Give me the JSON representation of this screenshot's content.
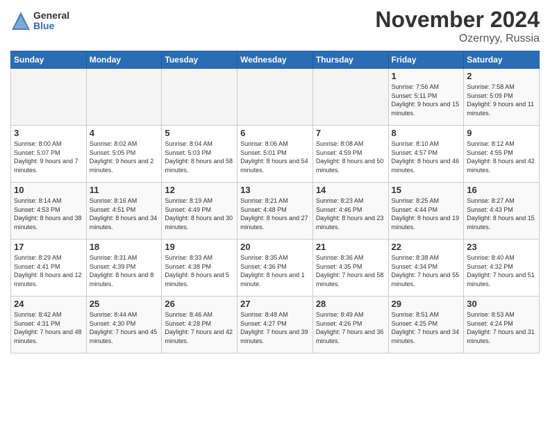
{
  "header": {
    "logo_general": "General",
    "logo_blue": "Blue",
    "title": "November 2024",
    "location": "Ozernyy, Russia"
  },
  "days_of_week": [
    "Sunday",
    "Monday",
    "Tuesday",
    "Wednesday",
    "Thursday",
    "Friday",
    "Saturday"
  ],
  "weeks": [
    [
      {
        "day": "",
        "info": ""
      },
      {
        "day": "",
        "info": ""
      },
      {
        "day": "",
        "info": ""
      },
      {
        "day": "",
        "info": ""
      },
      {
        "day": "",
        "info": ""
      },
      {
        "day": "1",
        "info": "Sunrise: 7:56 AM\nSunset: 5:11 PM\nDaylight: 9 hours and 15 minutes."
      },
      {
        "day": "2",
        "info": "Sunrise: 7:58 AM\nSunset: 5:09 PM\nDaylight: 9 hours and 11 minutes."
      }
    ],
    [
      {
        "day": "3",
        "info": "Sunrise: 8:00 AM\nSunset: 5:07 PM\nDaylight: 9 hours and 7 minutes."
      },
      {
        "day": "4",
        "info": "Sunrise: 8:02 AM\nSunset: 5:05 PM\nDaylight: 9 hours and 2 minutes."
      },
      {
        "day": "5",
        "info": "Sunrise: 8:04 AM\nSunset: 5:03 PM\nDaylight: 8 hours and 58 minutes."
      },
      {
        "day": "6",
        "info": "Sunrise: 8:06 AM\nSunset: 5:01 PM\nDaylight: 8 hours and 54 minutes."
      },
      {
        "day": "7",
        "info": "Sunrise: 8:08 AM\nSunset: 4:59 PM\nDaylight: 8 hours and 50 minutes."
      },
      {
        "day": "8",
        "info": "Sunrise: 8:10 AM\nSunset: 4:57 PM\nDaylight: 8 hours and 46 minutes."
      },
      {
        "day": "9",
        "info": "Sunrise: 8:12 AM\nSunset: 4:55 PM\nDaylight: 8 hours and 42 minutes."
      }
    ],
    [
      {
        "day": "10",
        "info": "Sunrise: 8:14 AM\nSunset: 4:53 PM\nDaylight: 8 hours and 38 minutes."
      },
      {
        "day": "11",
        "info": "Sunrise: 8:16 AM\nSunset: 4:51 PM\nDaylight: 8 hours and 34 minutes."
      },
      {
        "day": "12",
        "info": "Sunrise: 8:19 AM\nSunset: 4:49 PM\nDaylight: 8 hours and 30 minutes."
      },
      {
        "day": "13",
        "info": "Sunrise: 8:21 AM\nSunset: 4:48 PM\nDaylight: 8 hours and 27 minutes."
      },
      {
        "day": "14",
        "info": "Sunrise: 8:23 AM\nSunset: 4:46 PM\nDaylight: 8 hours and 23 minutes."
      },
      {
        "day": "15",
        "info": "Sunrise: 8:25 AM\nSunset: 4:44 PM\nDaylight: 8 hours and 19 minutes."
      },
      {
        "day": "16",
        "info": "Sunrise: 8:27 AM\nSunset: 4:43 PM\nDaylight: 8 hours and 15 minutes."
      }
    ],
    [
      {
        "day": "17",
        "info": "Sunrise: 8:29 AM\nSunset: 4:41 PM\nDaylight: 8 hours and 12 minutes."
      },
      {
        "day": "18",
        "info": "Sunrise: 8:31 AM\nSunset: 4:39 PM\nDaylight: 8 hours and 8 minutes."
      },
      {
        "day": "19",
        "info": "Sunrise: 8:33 AM\nSunset: 4:38 PM\nDaylight: 8 hours and 5 minutes."
      },
      {
        "day": "20",
        "info": "Sunrise: 8:35 AM\nSunset: 4:36 PM\nDaylight: 8 hours and 1 minute."
      },
      {
        "day": "21",
        "info": "Sunrise: 8:36 AM\nSunset: 4:35 PM\nDaylight: 7 hours and 58 minutes."
      },
      {
        "day": "22",
        "info": "Sunrise: 8:38 AM\nSunset: 4:34 PM\nDaylight: 7 hours and 55 minutes."
      },
      {
        "day": "23",
        "info": "Sunrise: 8:40 AM\nSunset: 4:32 PM\nDaylight: 7 hours and 51 minutes."
      }
    ],
    [
      {
        "day": "24",
        "info": "Sunrise: 8:42 AM\nSunset: 4:31 PM\nDaylight: 7 hours and 48 minutes."
      },
      {
        "day": "25",
        "info": "Sunrise: 8:44 AM\nSunset: 4:30 PM\nDaylight: 7 hours and 45 minutes."
      },
      {
        "day": "26",
        "info": "Sunrise: 8:46 AM\nSunset: 4:28 PM\nDaylight: 7 hours and 42 minutes."
      },
      {
        "day": "27",
        "info": "Sunrise: 8:48 AM\nSunset: 4:27 PM\nDaylight: 7 hours and 39 minutes."
      },
      {
        "day": "28",
        "info": "Sunrise: 8:49 AM\nSunset: 4:26 PM\nDaylight: 7 hours and 36 minutes."
      },
      {
        "day": "29",
        "info": "Sunrise: 8:51 AM\nSunset: 4:25 PM\nDaylight: 7 hours and 34 minutes."
      },
      {
        "day": "30",
        "info": "Sunrise: 8:53 AM\nSunset: 4:24 PM\nDaylight: 7 hours and 31 minutes."
      }
    ]
  ]
}
